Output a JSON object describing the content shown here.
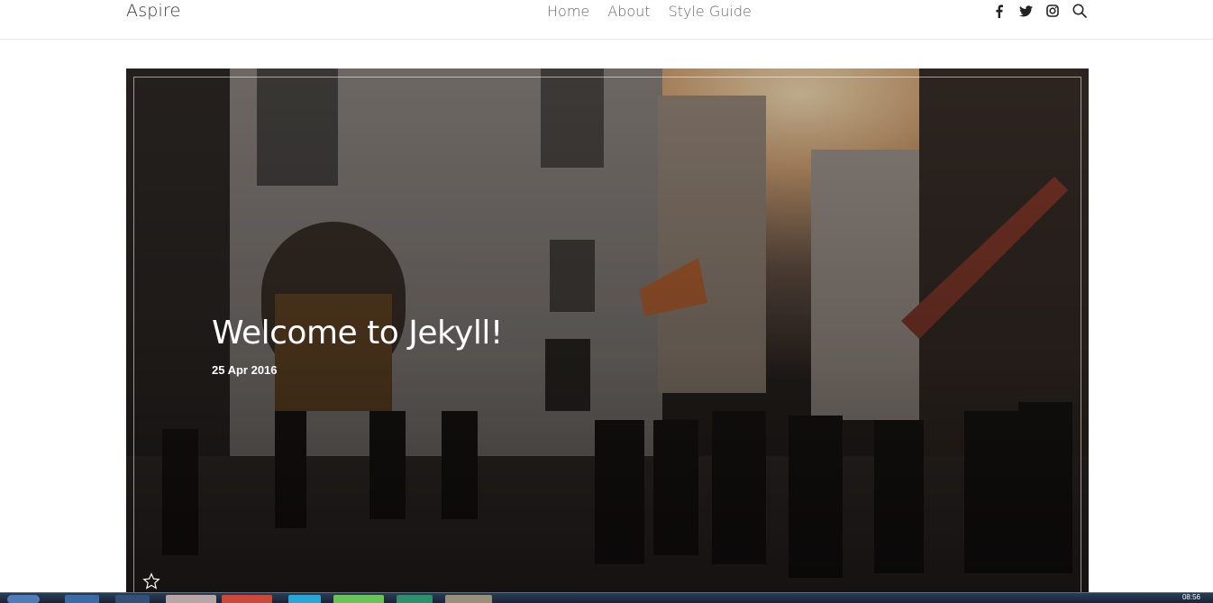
{
  "site": {
    "brand": "Aspire",
    "nav": [
      "Home",
      "About",
      "Style Guide"
    ],
    "social_icons": [
      "facebook-icon",
      "twitter-icon",
      "instagram-icon",
      "search-icon"
    ]
  },
  "hero": {
    "title": "Welcome to Jekyll!",
    "date": "25 Apr 2016",
    "icon": "star-icon"
  },
  "taskbar": {
    "clock": "08:56"
  },
  "colors": {
    "text_dark": "#333333",
    "nav_text": "#666666",
    "hero_text": "#ffffff",
    "taskbar": "#1c2c44"
  }
}
